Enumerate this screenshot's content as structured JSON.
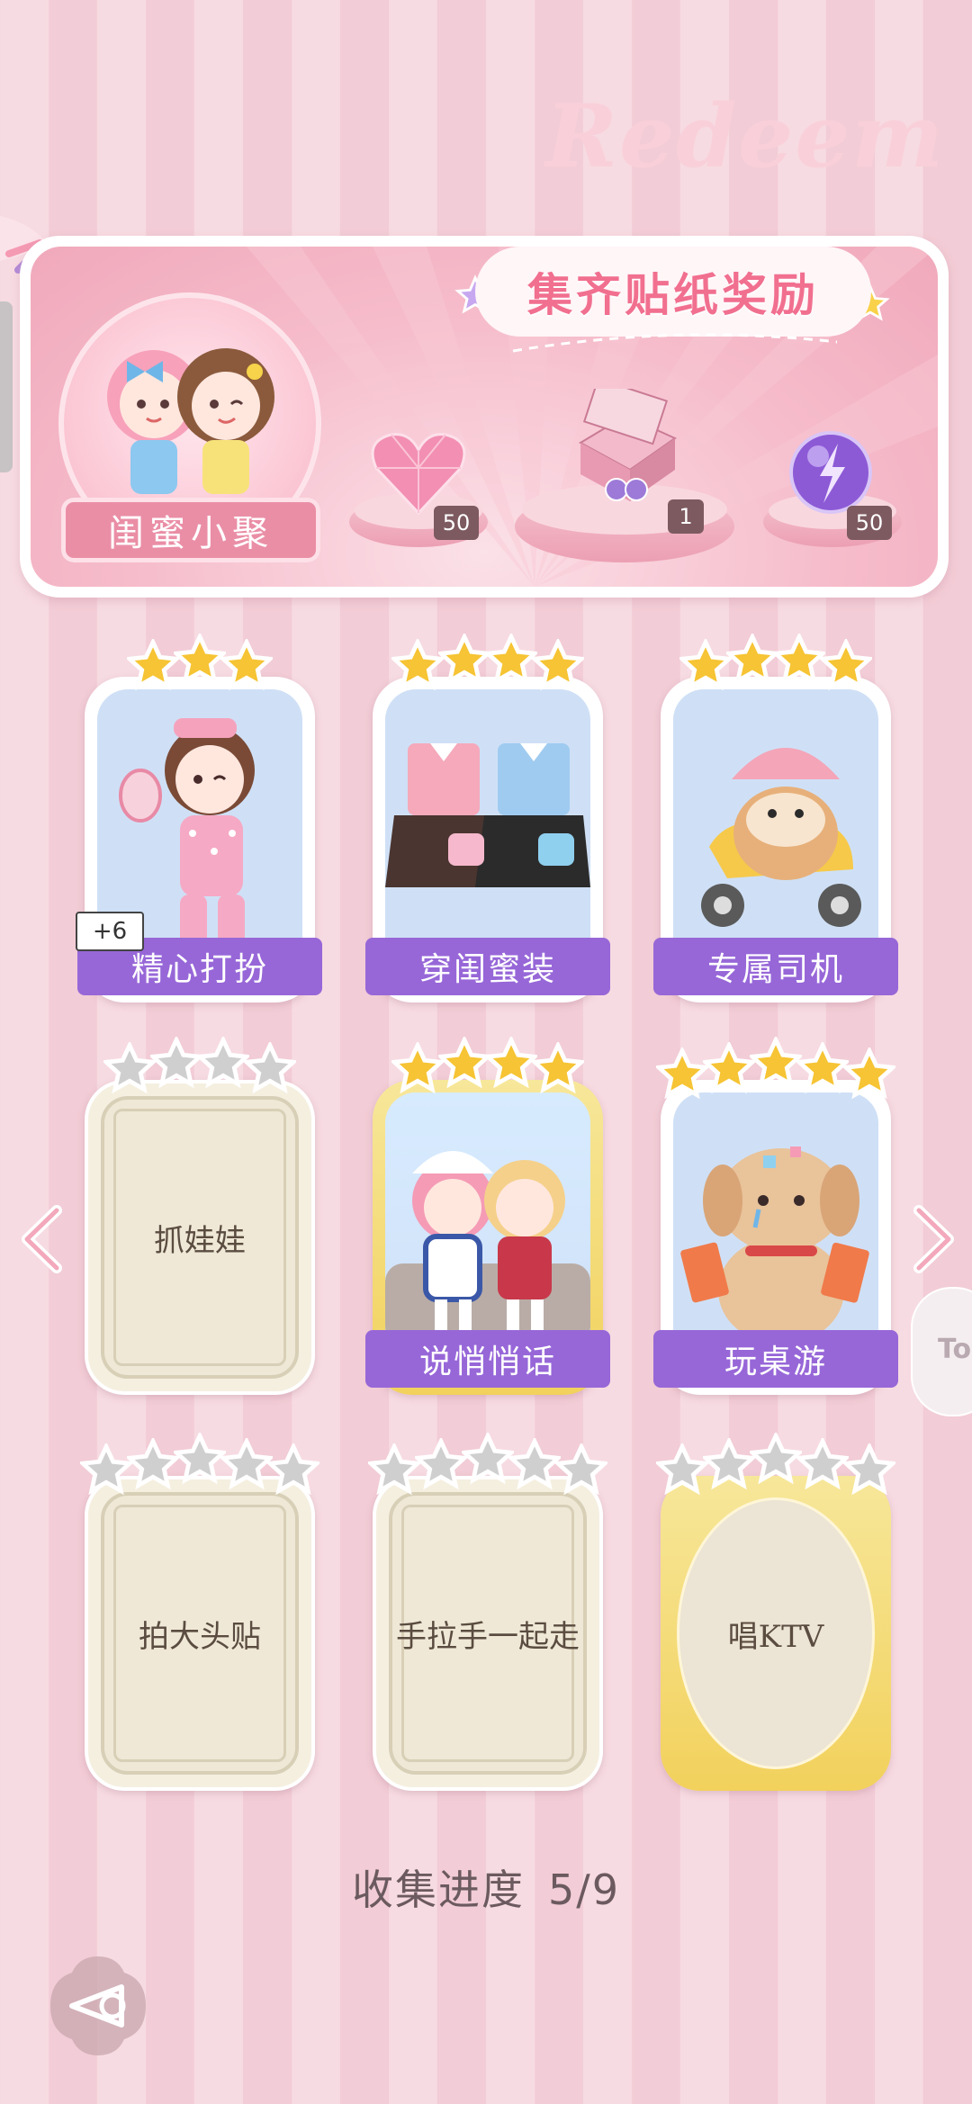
{
  "header": {
    "title": "集齐贴纸奖励",
    "watermark": "Redeem",
    "album_name": "闺蜜小聚",
    "rewards": [
      {
        "icon": "pink-heart-gem-icon",
        "count": "50"
      },
      {
        "icon": "gift-box-icon",
        "count": "1"
      },
      {
        "icon": "energy-orb-icon",
        "count": "50"
      }
    ]
  },
  "cards": [
    {
      "name": "精心打扮",
      "stars": 3,
      "max_stars": 3,
      "collected": true,
      "bonus": "+6"
    },
    {
      "name": "穿闺蜜装",
      "stars": 4,
      "max_stars": 4,
      "collected": true
    },
    {
      "name": "专属司机",
      "stars": 4,
      "max_stars": 4,
      "collected": true
    },
    {
      "name": "抓娃娃",
      "stars": 0,
      "max_stars": 4,
      "collected": false
    },
    {
      "name": "说悄悄话",
      "stars": 4,
      "max_stars": 4,
      "collected": true
    },
    {
      "name": "玩桌游",
      "stars": 5,
      "max_stars": 5,
      "collected": true
    },
    {
      "name": "拍大头贴",
      "stars": 0,
      "max_stars": 5,
      "collected": false
    },
    {
      "name": "手拉手一起走",
      "stars": 0,
      "max_stars": 5,
      "collected": false
    },
    {
      "name": "唱KTV",
      "stars": 0,
      "max_stars": 5,
      "collected": false
    }
  ],
  "progress": {
    "label": "收集进度",
    "value": "5/9"
  },
  "side_button": {
    "text": "To"
  },
  "colors": {
    "accent_purple": "#9767d8",
    "title_pink": "#f16f8f",
    "star_gold": "#f6c434",
    "star_gray": "#cfcfcf"
  }
}
